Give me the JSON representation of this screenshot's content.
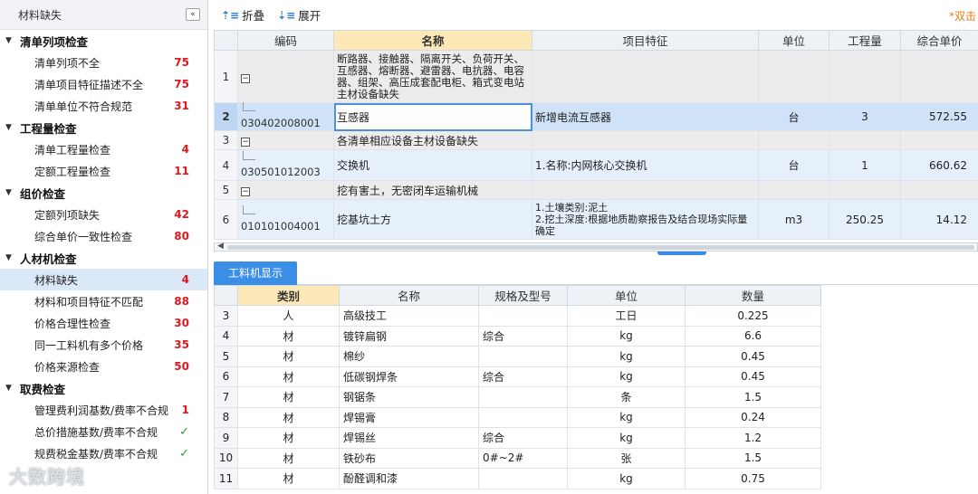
{
  "sidebar": {
    "title": "材料缺失",
    "collapse_glyph": "«",
    "groups": [
      {
        "label": "清单列项检查",
        "items": [
          {
            "label": "清单列项不全",
            "count": "75"
          },
          {
            "label": "清单项目特征描述不全",
            "count": "75"
          },
          {
            "label": "清单单位不符合规范",
            "count": "31"
          }
        ]
      },
      {
        "label": "工程量检查",
        "items": [
          {
            "label": "清单工程量检查",
            "count": "4"
          },
          {
            "label": "定额工程量检查",
            "count": "11"
          }
        ]
      },
      {
        "label": "组价检查",
        "items": [
          {
            "label": "定额列项缺失",
            "count": "42"
          },
          {
            "label": "综合单价一致性检查",
            "count": "80"
          }
        ]
      },
      {
        "label": "人材机检查",
        "items": [
          {
            "label": "材料缺失",
            "count": "4"
          },
          {
            "label": "材料和项目特征不匹配",
            "count": "88"
          },
          {
            "label": "价格合理性检查",
            "count": "30"
          },
          {
            "label": "同一工料机有多个价格",
            "count": "35"
          },
          {
            "label": "价格来源检查",
            "count": "50"
          }
        ]
      },
      {
        "label": "取费检查",
        "items": [
          {
            "label": "管理费利润基数/费率不合规",
            "count": "1"
          },
          {
            "label": "总价措施基数/费率不合规",
            "check": "✓"
          },
          {
            "label": "规费税金基数/费率不合规",
            "check": "✓"
          }
        ]
      }
    ],
    "watermark": "大数跨境"
  },
  "toolbar": {
    "collapse_label": "折叠",
    "expand_label": "展开",
    "hint": "*双击"
  },
  "upper_table": {
    "headers": [
      "编码",
      "名称",
      "项目特征",
      "单位",
      "工程量",
      "综合单价"
    ],
    "rows": [
      {
        "rn": "1",
        "code": "",
        "name": "断路器、接触器、隔离开关、负荷开关、互感器、熔断器、避雷器、电抗器、电容器、组架、高压成套配电柜、箱式变电站主材设备缺失",
        "feature": "",
        "unit": "",
        "qty": "",
        "price": ""
      },
      {
        "rn": "2",
        "code": "030402008001",
        "name": "互感器",
        "feature": "新增电流互感器",
        "unit": "台",
        "qty": "3",
        "price": "572.55"
      },
      {
        "rn": "3",
        "code": "",
        "name": "各清单相应设备主材设备缺失",
        "feature": "",
        "unit": "",
        "qty": "",
        "price": ""
      },
      {
        "rn": "4",
        "code": "030501012003",
        "name": "交换机",
        "feature": "1.名称:内网核心交换机",
        "unit": "台",
        "qty": "1",
        "price": "660.62"
      },
      {
        "rn": "5",
        "code": "",
        "name": "挖有害土，无密闭车运输机械",
        "feature": "",
        "unit": "",
        "qty": "",
        "price": ""
      },
      {
        "rn": "6",
        "code": "010101004001",
        "name": "挖基坑土方",
        "feature": "1.土壤类别:泥土\n2.挖土深度:根据地质勘察报告及结合现场实际量确定",
        "unit": "m3",
        "qty": "250.25",
        "price": "14.12"
      }
    ]
  },
  "tab_label": "工料机显示",
  "lower_table": {
    "headers": [
      "类别",
      "名称",
      "规格及型号",
      "单位",
      "数量"
    ],
    "rows": [
      {
        "rn": "3",
        "type": "人",
        "name": "高级技工",
        "spec": "",
        "unit": "工日",
        "qty": "0.225"
      },
      {
        "rn": "4",
        "type": "材",
        "name": "镀锌扁钢",
        "spec": "综合",
        "unit": "kg",
        "qty": "6.6"
      },
      {
        "rn": "5",
        "type": "材",
        "name": "棉纱",
        "spec": "",
        "unit": "kg",
        "qty": "0.45"
      },
      {
        "rn": "6",
        "type": "材",
        "name": "低碳钢焊条",
        "spec": "综合",
        "unit": "kg",
        "qty": "0.45"
      },
      {
        "rn": "7",
        "type": "材",
        "name": "钢锯条",
        "spec": "",
        "unit": "条",
        "qty": "1.5"
      },
      {
        "rn": "8",
        "type": "材",
        "name": "焊锡膏",
        "spec": "",
        "unit": "kg",
        "qty": "0.24"
      },
      {
        "rn": "9",
        "type": "材",
        "name": "焊锡丝",
        "spec": "综合",
        "unit": "kg",
        "qty": "1.2"
      },
      {
        "rn": "10",
        "type": "材",
        "name": "铁砂布",
        "spec": "0#~2#",
        "unit": "张",
        "qty": "1.5"
      },
      {
        "rn": "11",
        "type": "材",
        "name": "酚醛调和漆",
        "spec": "",
        "unit": "kg",
        "qty": "0.75"
      }
    ]
  }
}
